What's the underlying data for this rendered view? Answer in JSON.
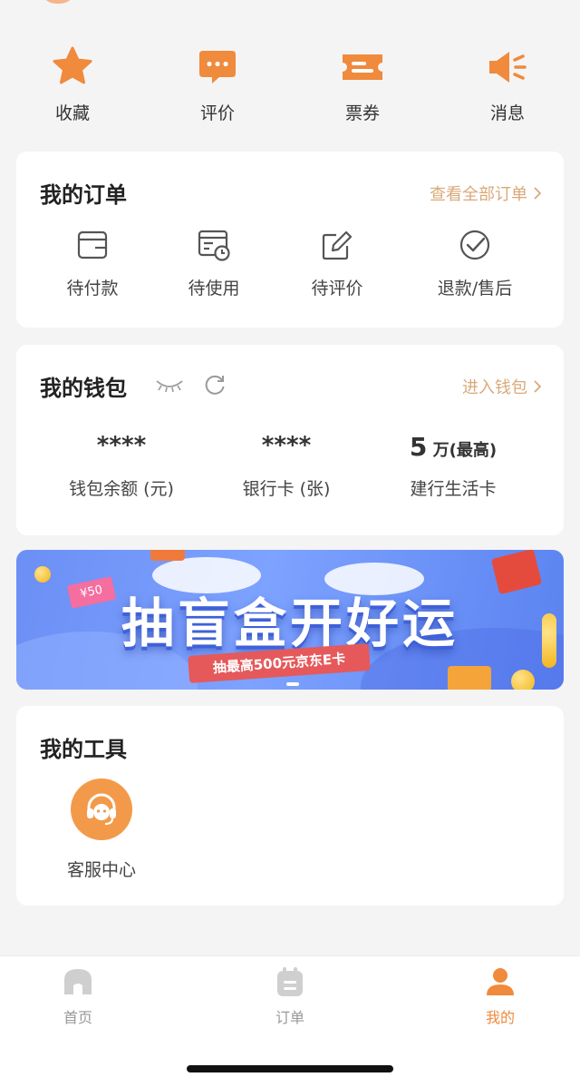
{
  "quick_actions": [
    {
      "label": "收藏",
      "icon": "star-icon"
    },
    {
      "label": "评价",
      "icon": "comment-icon"
    },
    {
      "label": "票券",
      "icon": "ticket-icon"
    },
    {
      "label": "消息",
      "icon": "megaphone-icon"
    }
  ],
  "orders": {
    "title": "我的订单",
    "view_all": "查看全部订单",
    "items": [
      {
        "label": "待付款",
        "icon": "wallet-icon"
      },
      {
        "label": "待使用",
        "icon": "calendar-clock-icon"
      },
      {
        "label": "待评价",
        "icon": "edit-icon"
      },
      {
        "label": "退款/售后",
        "icon": "check-circle-icon"
      }
    ]
  },
  "wallet": {
    "title": "我的钱包",
    "enter": "进入钱包",
    "items": [
      {
        "value": "****",
        "label": "钱包余额 (元)"
      },
      {
        "value": "****",
        "label": "银行卡 (张)"
      },
      {
        "value_num": "5",
        "value_unit": " 万(最高)",
        "label": "建行生活卡"
      }
    ]
  },
  "banner": {
    "title": "抽盲盒开好运",
    "subtitle": "抽最高500元京东E卡",
    "tag": "¥50"
  },
  "tools": {
    "title": "我的工具",
    "items": [
      {
        "label": "客服中心",
        "icon": "headset-icon"
      }
    ]
  },
  "tabbar": {
    "items": [
      {
        "label": "首页",
        "icon": "home-icon",
        "active": false
      },
      {
        "label": "订单",
        "icon": "order-icon",
        "active": false
      },
      {
        "label": "我的",
        "icon": "user-icon",
        "active": true
      }
    ]
  },
  "colors": {
    "accent": "#f08a3c",
    "link": "#d9a97a",
    "background": "#f4f4f4",
    "inactive_tab": "#cfcfcf"
  }
}
